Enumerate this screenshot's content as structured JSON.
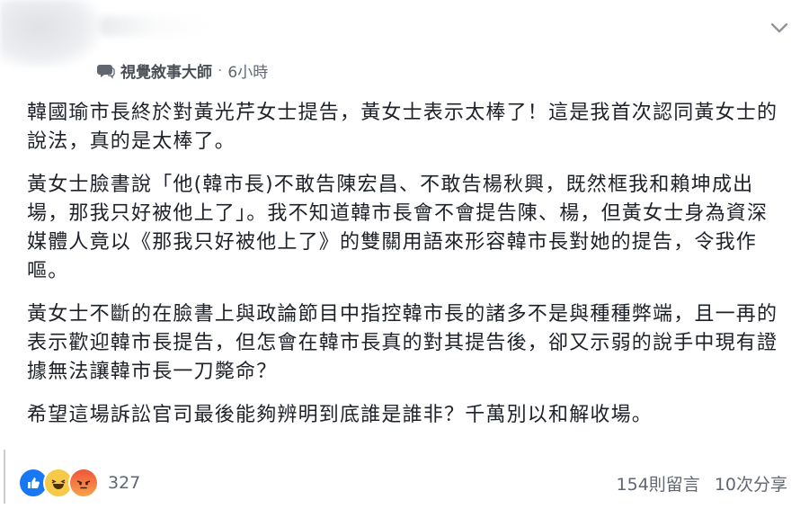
{
  "post": {
    "author": "視覺敘事大師",
    "separator": "·",
    "time": "6小時",
    "paragraphs": [
      "韓國瑜市長終於對黃光芹女士提告，黃女士表示太棒了！這是我首次認同黃女士的說法，真的是太棒了。",
      "黃女士臉書說「他(韓市長)不敢告陳宏昌、不敢告楊秋興，既然框我和賴坤成出場，那我只好被他上了」。我不知道韓市長會不會提告陳、楊，但黃女士身為資深媒體人竟以《那我只好被他上了》的雙關用語來形容韓市長對她的提告，令我作嘔。",
      "黃女士不斷的在臉書上與政論節目中指控韓市長的諸多不是與種種弊端，且一再的表示歡迎韓市長提告，但怎會在韓市長真的對其提告後，卻又示弱的說手中現有證據無法讓韓市長一刀斃命？",
      "希望這場訴訟官司最後能夠辨明到底誰是誰非？千萬別以和解收場。"
    ]
  },
  "footer": {
    "reactions": [
      "like-icon",
      "haha-icon",
      "angry-icon"
    ],
    "reaction_count": "327",
    "comments": "154則留言",
    "shares": "10次分享"
  },
  "colors": {
    "text": "#1d2129",
    "meta": "#606770",
    "like": "#1877f2",
    "haha": "#f7c948",
    "angry": "#f0553c"
  }
}
